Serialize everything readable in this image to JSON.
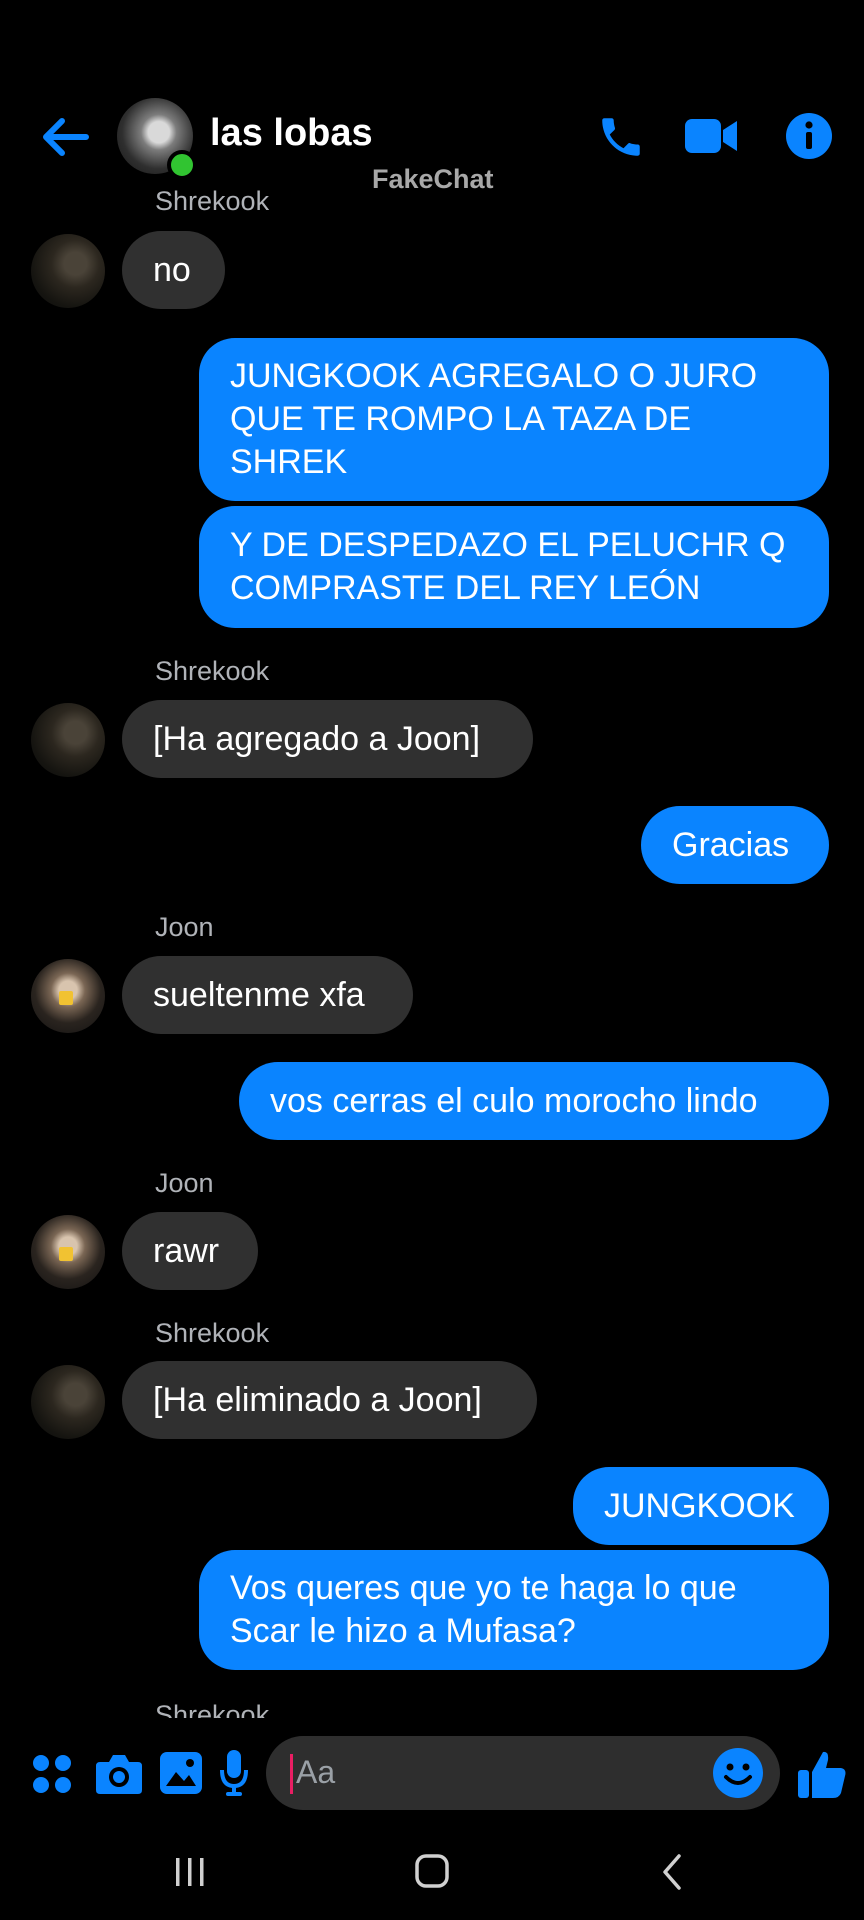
{
  "header": {
    "title": "las lobas",
    "watermark": "FakeChat",
    "back_icon": "arrow-left-icon",
    "call_icon": "phone-icon",
    "video_icon": "video-camera-icon",
    "info_icon": "info-icon"
  },
  "messages": {
    "top_cut_sender": "Shrekook",
    "m1": "no",
    "m2": [
      "JUNGKOOK AGREGALO O JURO",
      "QUE TE ROMPO LA TAZA DE",
      "SHREK"
    ],
    "m3": [
      "Y DE DESPEDAZO EL PELUCHR Q",
      "COMPRASTE DEL REY LEÓN"
    ],
    "s4": "Shrekook",
    "m4": "[Ha agregado a Joon]",
    "m5": "Gracias",
    "s6": "Joon",
    "m6": "sueltenme xfa",
    "m7": "vos cerras el culo morocho lindo",
    "s8": "Joon",
    "m8": "rawr",
    "s9": "Shrekook",
    "m9": "[Ha eliminado a Joon]",
    "m10": "JUNGKOOK",
    "m11": [
      "Vos queres que yo te haga lo que",
      "Scar le hizo a Mufasa?"
    ],
    "bottom_cut_sender": "Shrekook"
  },
  "composer": {
    "placeholder": "Aa",
    "icons": [
      "grid-menu-icon",
      "camera-icon",
      "image-icon",
      "microphone-icon",
      "emoji-icon",
      "thumbs-up-icon"
    ]
  },
  "colors": {
    "accent": "#0a84ff",
    "incoming_bubble": "#303030",
    "background": "#000000",
    "online": "#31c431"
  }
}
